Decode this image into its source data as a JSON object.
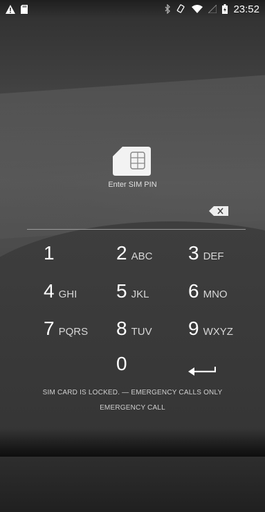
{
  "status_bar": {
    "time": "23:52",
    "left_icons": [
      "warning-icon",
      "sd-card-icon"
    ],
    "right_icons": [
      "bluetooth-icon",
      "rotate-icon",
      "wifi-icon",
      "no-signal-icon",
      "battery-icon"
    ]
  },
  "lock": {
    "prompt": "Enter SIM PIN",
    "icons": [
      "sim-card-icon",
      "backspace-icon"
    ]
  },
  "keypad": [
    {
      "digit": "1",
      "letters": ""
    },
    {
      "digit": "2",
      "letters": "ABC"
    },
    {
      "digit": "3",
      "letters": "DEF"
    },
    {
      "digit": "4",
      "letters": "GHI"
    },
    {
      "digit": "5",
      "letters": "JKL"
    },
    {
      "digit": "6",
      "letters": "MNO"
    },
    {
      "digit": "7",
      "letters": "PQRS"
    },
    {
      "digit": "8",
      "letters": "TUV"
    },
    {
      "digit": "9",
      "letters": "WXYZ"
    },
    {
      "digit": "0",
      "letters": ""
    }
  ],
  "enter_key": "enter-arrow-icon",
  "footer": {
    "status": "SIM CARD IS LOCKED. — EMERGENCY CALLS ONLY",
    "emergency_call": "EMERGENCY CALL"
  }
}
